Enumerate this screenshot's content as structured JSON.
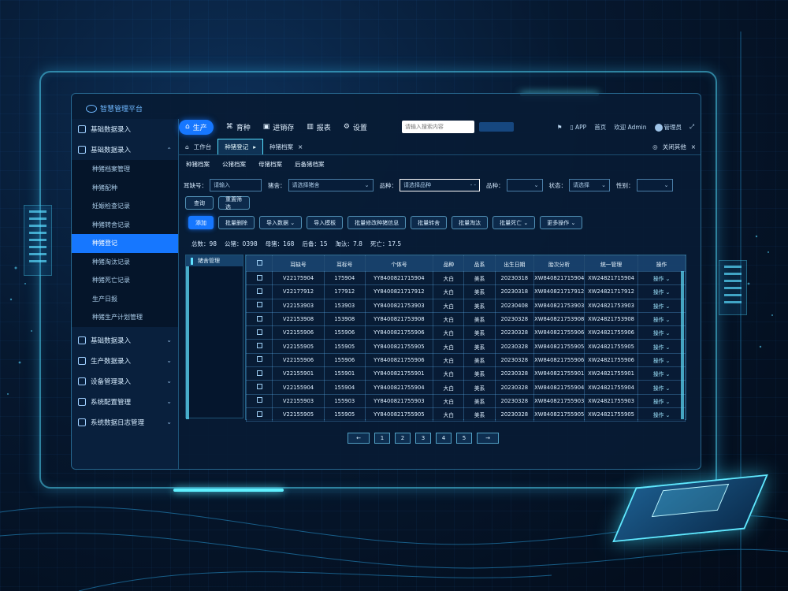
{
  "app": {
    "logo_text": "智慧管理平台"
  },
  "topnav": {
    "items": [
      {
        "icon": "⌂",
        "label": "生产",
        "active": true
      },
      {
        "icon": "⌘",
        "label": "育种",
        "active": false
      },
      {
        "icon": "▣",
        "label": "进销存",
        "active": false
      },
      {
        "icon": "▥",
        "label": "报表",
        "active": false
      },
      {
        "icon": "⚙",
        "label": "设置",
        "active": false
      }
    ],
    "search_placeholder": "请输入搜索内容",
    "app_label": "APP",
    "home_label": "首页",
    "account_label": "欢迎 Admin",
    "user_label": "管理员"
  },
  "sidebar": {
    "group1": "基础数据录入",
    "group2": "基础数据录入",
    "items": [
      "种猪档案管理",
      "种猪配种",
      "妊娠检查记录",
      "种猪转舍记录",
      "种猪登记",
      "种猪淘汰记录",
      "种猪死亡记录",
      "生产日报",
      "种猪生产计划管理"
    ],
    "groups_bottom": [
      "基础数据录入",
      "生产数据录入",
      "设备管理录入",
      "系统配置管理",
      "系统数据日志管理"
    ]
  },
  "tabs": {
    "home": "工作台",
    "active": "种猪登记",
    "second": "种猪档案",
    "right": "关闭其他"
  },
  "subtabs": [
    "种猪档案",
    "公猪档案",
    "母猪档案",
    "后备猪档案"
  ],
  "filters": {
    "label1": "耳缺号：",
    "value1": "请输入",
    "label2": "猪舍：",
    "value2": "请选择猪舍",
    "label3": "品种：",
    "value3": "请选择品种",
    "value3b": "- -",
    "label4": "品种：",
    "label5": "状态：",
    "value5": "请选择",
    "label6": "性别："
  },
  "buttons_row2": [
    "查询",
    "重置筛选"
  ],
  "buttons_row3": [
    "添加",
    "批量删除",
    "导入数据",
    "导入模板",
    "批量修改种猪信息",
    "批量转舍",
    "批量淘汰",
    "批量死亡",
    "更多操作"
  ],
  "summary": {
    "total_label": "总数：",
    "total": "98",
    "boar_label": "公猪：",
    "boar": "0398",
    "sow_label": "母猪：",
    "sow": "168",
    "reserve_label": "后备：",
    "reserve": "15",
    "cull_label": "淘汰：",
    "cull": "7.8",
    "death_label": "死亡：",
    "death": "17.5"
  },
  "tree": {
    "header": "猪舍管理"
  },
  "table": {
    "headers": [
      "",
      "耳缺号",
      "耳标号",
      "个体号",
      "品种",
      "品系",
      "出生日期",
      "胎次分析",
      "统一管理",
      "操作"
    ],
    "rows": [
      [
        "V22175904",
        "175904",
        "YY8400821715904",
        "大白",
        "美系",
        "20230318",
        "XW840821715904",
        "XW24821715904",
        "操作"
      ],
      [
        "V22177912",
        "177912",
        "YY8400821717912",
        "大白",
        "美系",
        "20230318",
        "XW840821717912",
        "XW24821717912",
        "操作"
      ],
      [
        "V22153903",
        "153903",
        "YY8400821753903",
        "大白",
        "美系",
        "20230408",
        "XW840821753903",
        "XW24821753903",
        "操作"
      ],
      [
        "V22153908",
        "153908",
        "YY8400821753908",
        "大白",
        "美系",
        "20230328",
        "XW840821753908",
        "XW24821753908",
        "操作"
      ],
      [
        "V22155906",
        "155906",
        "YY8400821755906",
        "大白",
        "美系",
        "20230328",
        "XW840821755906",
        "XW24821755906",
        "操作"
      ],
      [
        "V22155905",
        "155905",
        "YY8400821755905",
        "大白",
        "美系",
        "20230328",
        "XW840821755905",
        "XW24821755905",
        "操作"
      ],
      [
        "V22155906",
        "155906",
        "YY8400821755906",
        "大白",
        "美系",
        "20230328",
        "XW840821755906",
        "XW24821755906",
        "操作"
      ],
      [
        "V22155901",
        "155901",
        "YY8400821755901",
        "大白",
        "美系",
        "20230328",
        "XW840821755901",
        "XW24821755901",
        "操作"
      ],
      [
        "V22155904",
        "155904",
        "YY8400821755904",
        "大白",
        "美系",
        "20230328",
        "XW840821755904",
        "XW24821755904",
        "操作"
      ],
      [
        "V22155903",
        "155903",
        "YY8400821755903",
        "大白",
        "美系",
        "20230328",
        "XW840821755903",
        "XW24821755903",
        "操作"
      ],
      [
        "V22155905",
        "155905",
        "YY8400821755905",
        "大白",
        "美系",
        "20230328",
        "XW840821755905",
        "XW24821755905",
        "操作"
      ]
    ]
  },
  "pager": [
    "←",
    "1",
    "2",
    "3",
    "4",
    "5",
    "→"
  ],
  "colors": {
    "accent": "#1677ff",
    "glow": "#5fe0ff",
    "panel": "#081b34"
  }
}
